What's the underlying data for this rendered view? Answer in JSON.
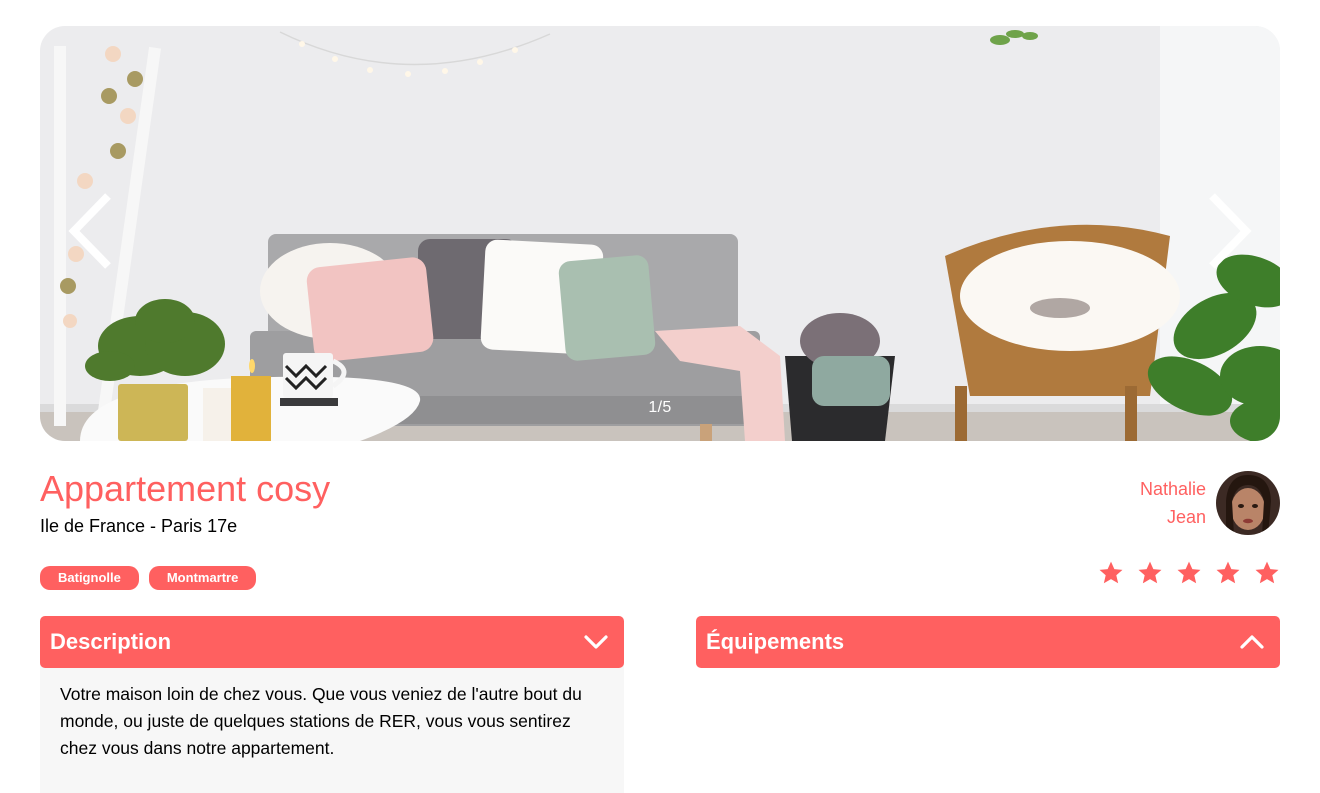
{
  "gallery": {
    "counter": "1/5",
    "prev_icon": "chevron-left-icon",
    "next_icon": "chevron-right-icon"
  },
  "listing": {
    "title": "Appartement cosy",
    "location": "Ile de France - Paris 17e",
    "tags": [
      "Batignolle",
      "Montmartre"
    ]
  },
  "host": {
    "first_name": "Nathalie",
    "last_name": "Jean"
  },
  "rating": {
    "value": 5,
    "max": 5,
    "icon": "star-icon"
  },
  "sections": {
    "description": {
      "title": "Description",
      "icon": "chevron-down-icon",
      "text": "Votre maison loin de chez vous. Que vous veniez de l'autre bout du monde, ou juste de quelques stations de RER, vous vous sentirez chez vous dans notre appartement."
    },
    "equipments": {
      "title": "Équipements",
      "icon": "chevron-up-icon"
    }
  },
  "colors": {
    "accent": "#FF6060",
    "panel_background": "#F7F7F7",
    "text": "#000000"
  }
}
